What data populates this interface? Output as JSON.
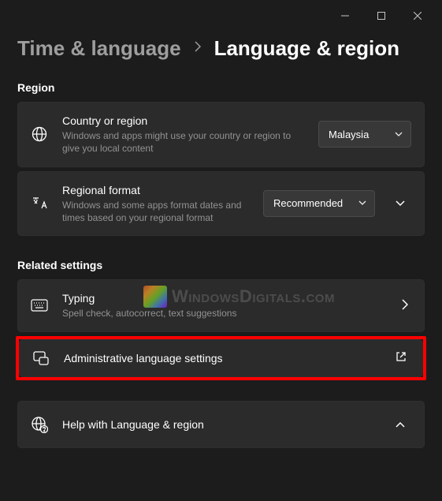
{
  "breadcrumb": {
    "parent": "Time & language",
    "current": "Language & region"
  },
  "region": {
    "label": "Region",
    "country": {
      "title": "Country or region",
      "sub": "Windows and apps might use your country or region to give you local content",
      "value": "Malaysia"
    },
    "format": {
      "title": "Regional format",
      "sub": "Windows and some apps format dates and times based on your regional format",
      "value": "Recommended"
    }
  },
  "related": {
    "label": "Related settings",
    "typing": {
      "title": "Typing",
      "sub": "Spell check, autocorrect, text suggestions"
    },
    "admin": {
      "title": "Administrative language settings"
    }
  },
  "help": {
    "title": "Help with Language & region"
  },
  "watermark": "WindowsDigitals.com"
}
